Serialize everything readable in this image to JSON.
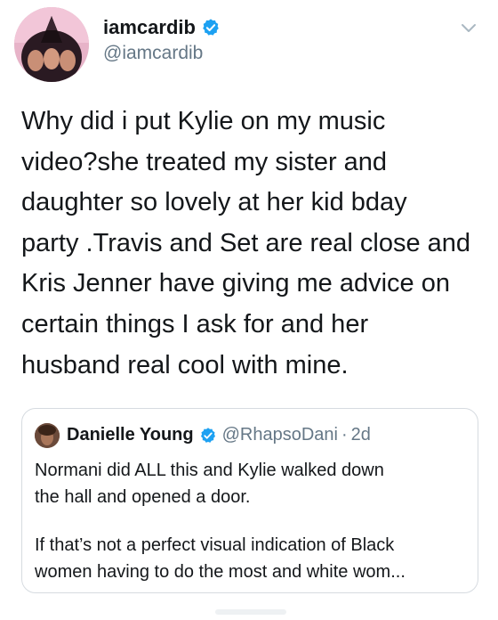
{
  "author": {
    "display_name": "iamcardib",
    "handle": "@iamcardib"
  },
  "tweet_lines": [
    "Why did i put Kylie on my music",
    "video?she treated my sister and",
    "daughter so lovely at her kid bday",
    "party .Travis and Set are real close and",
    "Kris Jenner have giving me advice on",
    "certain things I ask for and her",
    "husband real cool with mine."
  ],
  "quoted_tweet": {
    "display_name": "Danielle Young",
    "handle": "@RhapsoDani",
    "separator": "·",
    "time": "2d",
    "lines": [
      "Normani did ALL this and Kylie walked down",
      "the hall and opened a door.",
      "If that’s not a perfect visual indication of Black",
      "women having to do the most and white wom..."
    ]
  },
  "colors": {
    "verified_blue": "#1da1f2",
    "secondary_text": "#657786",
    "border": "#d6dbe0"
  },
  "icons": [
    "verified-badge-icon",
    "chevron-down-icon"
  ]
}
